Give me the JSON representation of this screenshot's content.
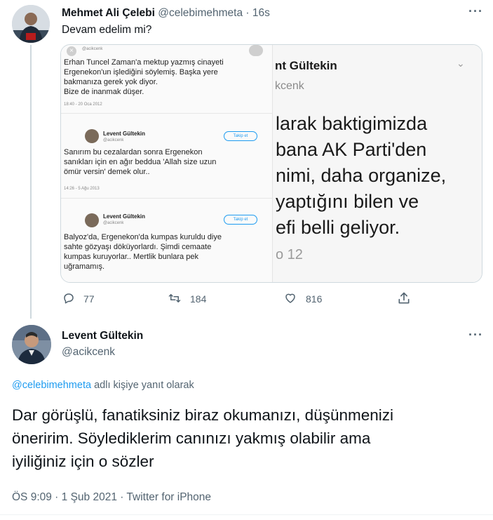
{
  "tweet1": {
    "author_name": "Mehmet Ali Çelebi",
    "handle": "@celebimehmeta",
    "separator": "·",
    "time": "16s",
    "text": "Devam edelim mi?",
    "more_label": "···",
    "media_left": {
      "block1": [
        "Erhan Tuncel Zaman'a mektup yazmış cinayeti",
        "Ergenekon'un işlediğini söylemiş. Başka yere",
        "bakmanıza gerek yok diyor.",
        "Bize de inanmak düşer."
      ],
      "block1_date": "18:40 - 20 Oca 2012",
      "block1_handle": "@acikcenk",
      "post2_name": "Levent Gültekin",
      "post2_handle": "@acikcenk",
      "follow_label": "Takip et",
      "block2": [
        "Sanırım bu cezalardan sonra  Ergenekon",
        "sanıkları için en ağır beddua 'Allah size uzun",
        "ömür versin' demek olur.."
      ],
      "block2_date": "14:26 - 5 Ağu 2013",
      "post3_name": "Levent Gültekin",
      "post3_handle": "@acikcenk",
      "block3": [
        "Balyoz'da, Ergenekon'da kumpas kuruldu diye",
        "sahte gözyaşı döküyorlardı. Şimdi cemaate",
        "kumpas kuruyorlar.. Mertlik bunlara pek",
        "uğramamış."
      ]
    },
    "media_right": {
      "name": "nt Gültekin",
      "handle": "kcenk",
      "lines": [
        "larak baktigimizda",
        "bana AK Parti'den",
        "nimi, daha organize,",
        "yaptığını bilen ve",
        "efi belli geliyor."
      ],
      "footer": "o 12"
    },
    "actions": {
      "reply_count": "77",
      "retweet_count": "184",
      "like_count": "816"
    }
  },
  "tweet2": {
    "author_name": "Levent Gültekin",
    "handle": "@acikcenk",
    "more_label": "···",
    "replying_mention": "@celebimehmeta",
    "replying_text": " adlı kişiye yanıt olarak",
    "body_lines": [
      "Dar görüşlü,  fanatiksiniz biraz okumanızı, düşünmenizi",
      "öneririm. Söylediklerim canınızı yakmış olabilir ama",
      "iyiliğiniz için o sözler"
    ],
    "meta": "ÖS 9:09 · 1 Şub 2021 · Twitter for iPhone"
  },
  "colors": {
    "link": "#1d9bf0",
    "secondary_text": "#536471",
    "divider": "#cfd9de"
  },
  "icons": [
    "reply-icon",
    "retweet-icon",
    "like-icon",
    "share-icon",
    "more-icon"
  ]
}
